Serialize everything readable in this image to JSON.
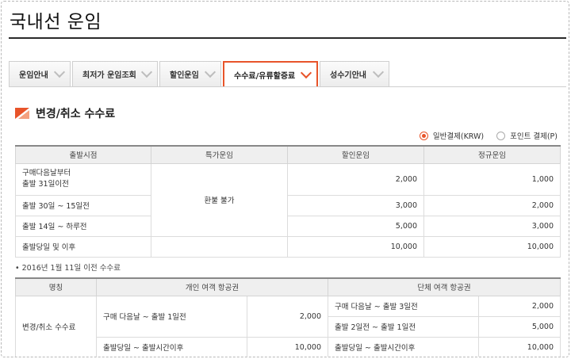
{
  "page": {
    "title": "국내선 운임"
  },
  "tabs": [
    {
      "label": "운임안내",
      "active": false
    },
    {
      "label": "최저가 운임조회",
      "active": false
    },
    {
      "label": "할인운임",
      "active": false
    },
    {
      "label": "수수료/유류할증료",
      "active": true
    },
    {
      "label": "성수기안내",
      "active": false
    }
  ],
  "section": {
    "title": "변경/취소 수수료"
  },
  "payment": {
    "option_krw": "일반결제(KRW)",
    "option_point": "포인트 결제(P)",
    "selected": "krw"
  },
  "table1": {
    "headers": [
      "출발시점",
      "특가운임",
      "할인운임",
      "정규운임"
    ],
    "special_merged": "환불 불가",
    "rows": [
      {
        "period_line1": "구매다음날부터",
        "period_line2": "출발 31일이전",
        "discount": "2,000",
        "regular": "1,000"
      },
      {
        "period": "출발 30일 ~ 15일전",
        "discount": "3,000",
        "regular": "2,000"
      },
      {
        "period": "출발 14일 ~ 하루전",
        "discount": "5,000",
        "regular": "3,000"
      },
      {
        "period": "출발당일 및 이후",
        "discount": "10,000",
        "regular": "10,000"
      }
    ]
  },
  "note": "• 2016년 1월 11일 이전 수수료",
  "table2": {
    "headers": [
      "명칭",
      "개인 여객 항공권",
      "단체 여객 항공권"
    ],
    "name": "변경/취소 수수료",
    "individual": [
      {
        "period": "구매 다음날 ~ 출발 1일전",
        "fee": "2,000"
      },
      {
        "period": "출발당일 ~ 출발시간이후",
        "fee": "10,000"
      }
    ],
    "group": [
      {
        "period": "구매 다음날 ~ 출발 3일전",
        "fee": "2,000"
      },
      {
        "period": "출발 2일전 ~ 출발 1일전",
        "fee": "5,000"
      },
      {
        "period": "출발당일 ~ 출발시간이후",
        "fee": "10,000"
      }
    ]
  },
  "colors": {
    "accent": "#e8542a",
    "header_bg": "#efefef",
    "border": "#d4d4d4"
  }
}
